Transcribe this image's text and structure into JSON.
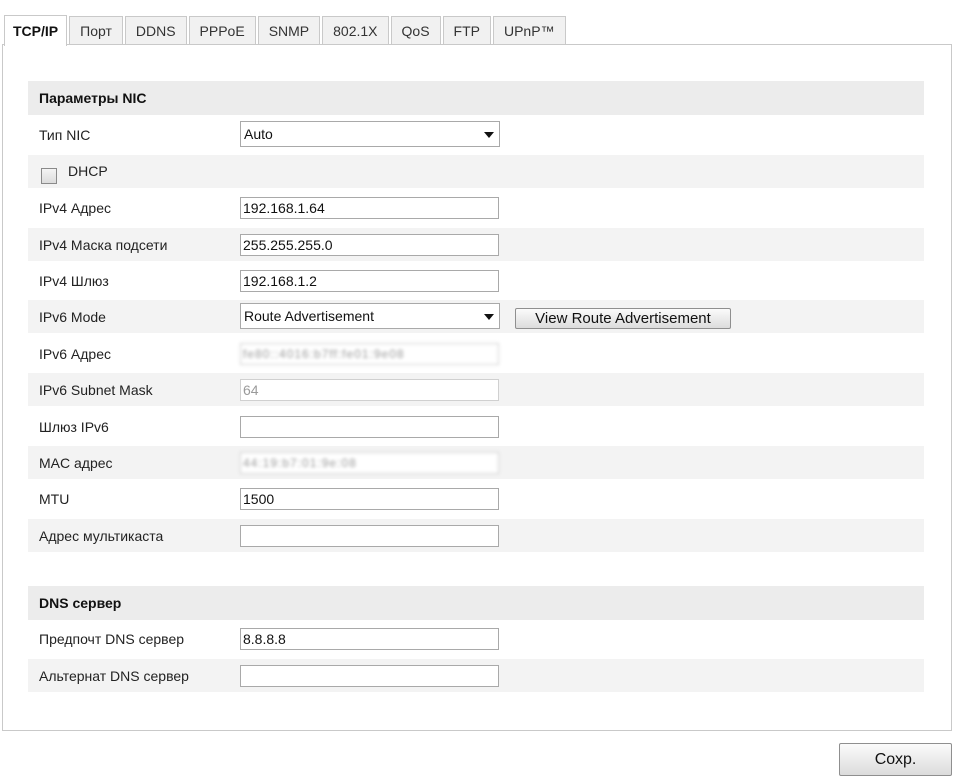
{
  "tabs": [
    {
      "label": "TCP/IP",
      "active": true
    },
    {
      "label": "Порт"
    },
    {
      "label": "DDNS"
    },
    {
      "label": "PPPoE"
    },
    {
      "label": "SNMP"
    },
    {
      "label": "802.1X"
    },
    {
      "label": "QoS"
    },
    {
      "label": "FTP"
    },
    {
      "label": "UPnP™"
    }
  ],
  "nic": {
    "title": "Параметры NIC",
    "nic_type_label": "Тип NIC",
    "nic_type_value": "Auto",
    "dhcp_label": "DHCP",
    "dhcp_checked": false,
    "ipv4_address_label": "IPv4 Адрес",
    "ipv4_address_value": "192.168.1.64",
    "ipv4_mask_label": "IPv4 Маска подсети",
    "ipv4_mask_value": "255.255.255.0",
    "ipv4_gateway_label": "IPv4 Шлюз",
    "ipv4_gateway_value": "192.168.1.2",
    "ipv6_mode_label": "IPv6 Mode",
    "ipv6_mode_value": "Route Advertisement",
    "view_route_label": "View Route Advertisement",
    "ipv6_address_label": "IPv6 Адрес",
    "ipv6_address_value": "fe80::4016:b7ff:fe01:9e08",
    "ipv6_mask_label": "IPv6 Subnet Mask",
    "ipv6_mask_value": "64",
    "ipv6_gateway_label": "Шлюз IPv6",
    "ipv6_gateway_value": "",
    "mac_label": "MAC адрес",
    "mac_value": "44:19:b7:01:9e:08",
    "mtu_label": "MTU",
    "mtu_value": "1500",
    "multicast_label": "Адрес мультикаста",
    "multicast_value": ""
  },
  "dns": {
    "title": "DNS сервер",
    "preferred_label": "Предпочт DNS сервер",
    "preferred_value": "8.8.8.8",
    "alternate_label": "Альтернат DNS сервер",
    "alternate_value": ""
  },
  "save_label": "Сохр."
}
